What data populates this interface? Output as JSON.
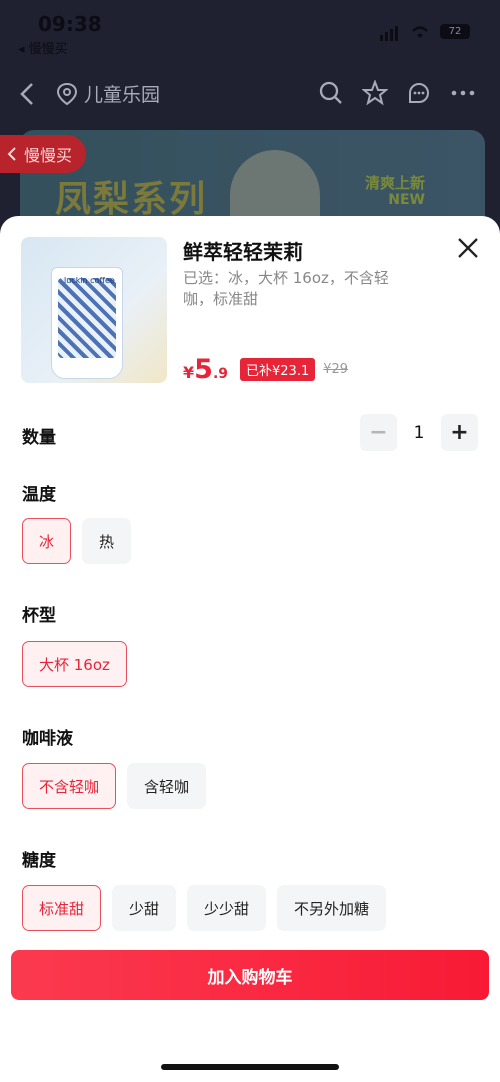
{
  "status": {
    "time": "09:38",
    "back_app": "◂ 慢慢买",
    "battery": "72"
  },
  "nav": {
    "location": "儿童乐园"
  },
  "banner": {
    "title": "凤梨系列",
    "new_cn": "清爽上新",
    "new_en": "NEW"
  },
  "slow_buy": {
    "label": "慢慢买"
  },
  "product": {
    "name": "鲜萃轻轻茉莉",
    "selected": "已选：冰，大杯 16oz，不含轻咖，标准甜",
    "price_symbol": "¥",
    "price_int": "5",
    "price_dec": ".9",
    "subsidy": "已补¥23.1",
    "original_price": "¥29",
    "logo_text": "luckin coffee"
  },
  "quantity": {
    "label": "数量",
    "value": "1",
    "minus": "−",
    "plus": "+"
  },
  "temperature": {
    "label": "温度",
    "options": [
      "冰",
      "热"
    ]
  },
  "cup": {
    "label": "杯型",
    "options": [
      "大杯 16oz"
    ]
  },
  "coffee": {
    "label": "咖啡液",
    "options": [
      "不含轻咖",
      "含轻咖"
    ]
  },
  "sugar": {
    "label": "糖度",
    "options": [
      "标准甜",
      "少甜",
      "少少甜",
      "不另外加糖"
    ]
  },
  "cta": {
    "add_to_cart": "加入购物车"
  },
  "colors": {
    "accent": "#e62538",
    "selected_bg": "#fff0f2"
  }
}
